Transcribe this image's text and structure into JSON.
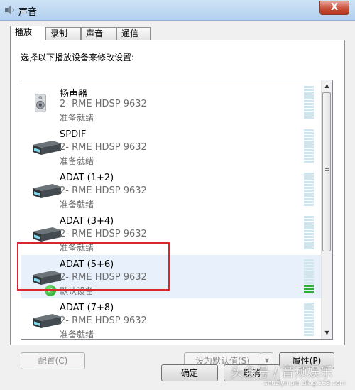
{
  "window": {
    "title": "声音",
    "close_glyph": "X"
  },
  "tabs": [
    {
      "label": "播放",
      "active": true
    },
    {
      "label": "录制",
      "active": false
    },
    {
      "label": "声音",
      "active": false
    },
    {
      "label": "通信",
      "active": false
    }
  ],
  "instruction": "选择以下播放设备来修改设置:",
  "devices": [
    {
      "name": "扬声器",
      "driver": "2- RME HDSP 9632",
      "status": "准备就绪",
      "icon": "speaker-icon"
    },
    {
      "name": "SPDIF",
      "driver": "2- RME HDSP 9632",
      "status": "准备就绪",
      "icon": "audio-device-icon"
    },
    {
      "name": "ADAT (1+2)",
      "driver": "2- RME HDSP 9632",
      "status": "准备就绪",
      "icon": "audio-device-icon"
    },
    {
      "name": "ADAT (3+4)",
      "driver": "2- RME HDSP 9632",
      "status": "准备就绪",
      "icon": "audio-device-icon"
    },
    {
      "name": "ADAT (5+6)",
      "driver": "2- RME HDSP 9632",
      "status": "默认设备",
      "icon": "audio-device-icon",
      "default": true,
      "level": 0.25
    },
    {
      "name": "ADAT (7+8)",
      "driver": "2- RME HDSP 9632",
      "status": "准备就绪",
      "icon": "audio-device-icon"
    }
  ],
  "buttons": {
    "configure": "配置(C)",
    "set_default": "设为默认值(S)",
    "properties": "属性(P)",
    "ok": "确定",
    "cancel": "取消"
  },
  "watermark": {
    "text": "头条号 / 音频娱乐",
    "url": "shuziyinpin.blog.163.com"
  },
  "colors": {
    "highlight": "#d6262e",
    "meter_on": "#2fae3a",
    "meter_off": "#cfe6ee"
  }
}
